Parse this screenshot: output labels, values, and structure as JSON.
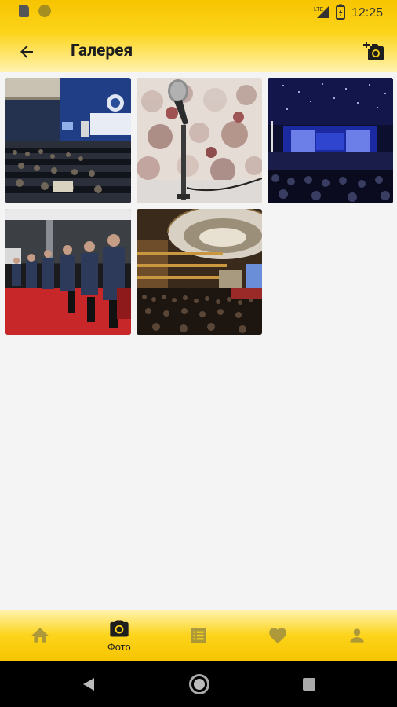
{
  "status_bar": {
    "time": "12:25",
    "network": "LTE"
  },
  "app_bar": {
    "title": "Галерея",
    "back_icon": "arrow-back-icon",
    "action_icon": "add-photo-icon"
  },
  "gallery": {
    "photos": [
      {
        "subject": "conference-hall-seated-audience"
      },
      {
        "subject": "microphone-closeup"
      },
      {
        "subject": "stage-blue-lights-audience"
      },
      {
        "subject": "audience-red-carpet-rows"
      },
      {
        "subject": "grand-auditorium-ceiling"
      }
    ]
  },
  "bottom_nav": {
    "items": [
      {
        "icon": "home-icon",
        "label": "",
        "active": false
      },
      {
        "icon": "camera-icon",
        "label": "Фото",
        "active": true
      },
      {
        "icon": "list-icon",
        "label": "",
        "active": false
      },
      {
        "icon": "heart-icon",
        "label": "",
        "active": false
      },
      {
        "icon": "person-icon",
        "label": "",
        "active": false
      }
    ]
  },
  "colors": {
    "accent": "#FCD41A",
    "inactive_icon": "#9a8a40",
    "active_icon": "#1e1e1e"
  }
}
